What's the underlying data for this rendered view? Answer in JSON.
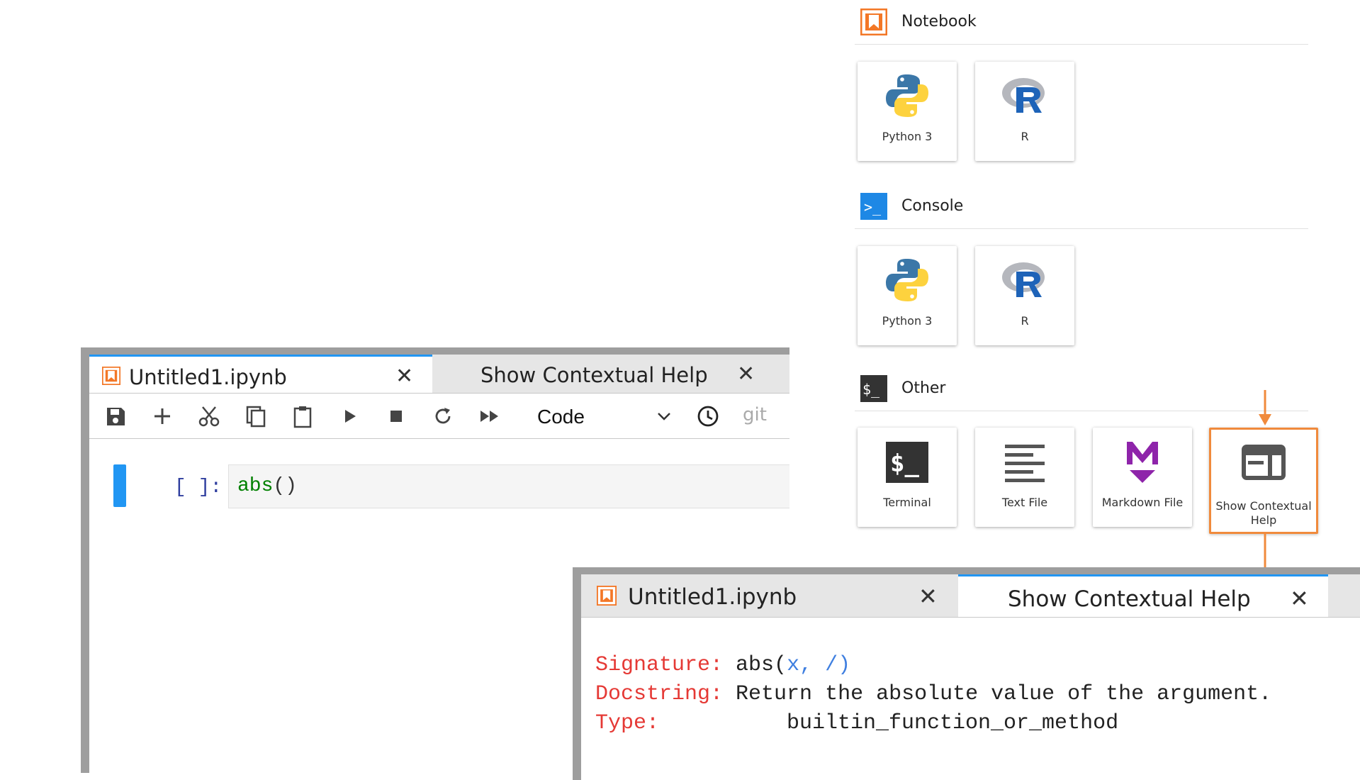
{
  "launcher": {
    "sections": [
      {
        "label": "Notebook",
        "icon": "notebook-icon",
        "cards": [
          {
            "label": "Python 3",
            "icon": "python-logo-icon"
          },
          {
            "label": "R",
            "icon": "r-logo-icon"
          }
        ]
      },
      {
        "label": "Console",
        "icon": "console-icon",
        "cards": [
          {
            "label": "Python 3",
            "icon": "python-logo-icon"
          },
          {
            "label": "R",
            "icon": "r-logo-icon"
          }
        ]
      },
      {
        "label": "Other",
        "icon": "terminal-section-icon",
        "cards": [
          {
            "label": "Terminal",
            "icon": "terminal-icon"
          },
          {
            "label": "Text File",
            "icon": "text-file-icon"
          },
          {
            "label": "Markdown File",
            "icon": "markdown-icon"
          },
          {
            "label": "Show Contextual Help",
            "icon": "contextual-help-icon",
            "highlighted": true
          }
        ]
      }
    ],
    "terminal_glyph": "$_",
    "console_glyph": ">_",
    "other_glyph": "$_"
  },
  "notebook": {
    "tabs": [
      {
        "label": "Untitled1.ipynb",
        "active": true
      },
      {
        "label": "Show Contextual Help",
        "active": false
      }
    ],
    "toolbar": {
      "cell_type": "Code",
      "git_label": "git"
    },
    "cell": {
      "prompt": "[ ]:",
      "code_func": "abs",
      "code_parens": "()"
    }
  },
  "help_panel": {
    "tabs": [
      {
        "label": "Untitled1.ipynb",
        "active": false
      },
      {
        "label": "Show Contextual Help",
        "active": true
      }
    ],
    "rows": [
      {
        "key": "Signature:",
        "value_pre": "abs(",
        "value_param": "x, /",
        "value_post": ")"
      },
      {
        "key": "Docstring:",
        "value": "Return the absolute value of the argument."
      },
      {
        "key": "Type:",
        "value": "builtin_function_or_method"
      }
    ]
  },
  "colors": {
    "accent_orange": "#f08a3c",
    "jupyter_orange": "#f37726",
    "active_tab_blue": "#2196f3",
    "doc_key_red": "#e53935"
  }
}
